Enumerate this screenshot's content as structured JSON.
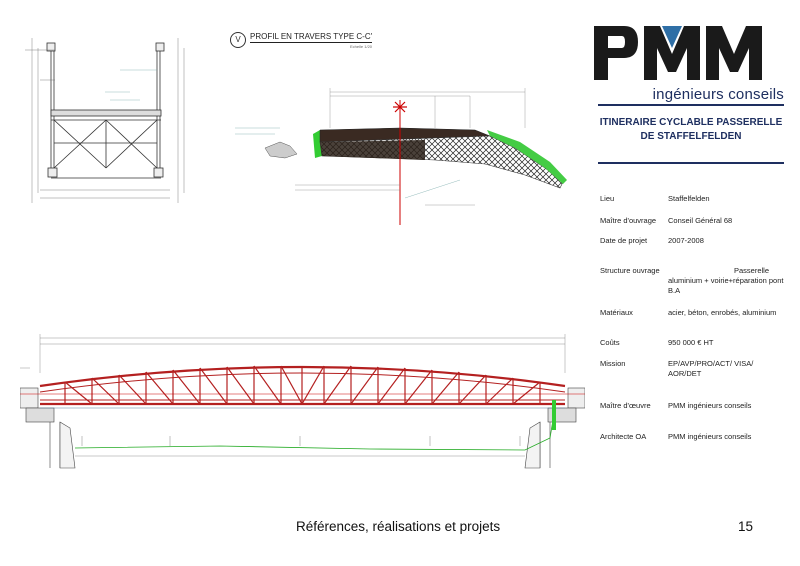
{
  "profile": {
    "marker": "V",
    "title": "PROFIL EN TRAVERS TYPE C-C'",
    "scale": "Echelle 1/20"
  },
  "logo": {
    "name": "PMM",
    "subtitle": "ingénieurs conseils",
    "colors": {
      "dark": "#1a1a1a",
      "blue": "#1e2f60",
      "accent": "#2f6fa6"
    }
  },
  "project": {
    "title_line1": "ITINERAIRE CYCLABLE PASSERELLE",
    "title_line2": "DE STAFFELFELDEN"
  },
  "details": {
    "lieu": {
      "label": "Lieu",
      "value": "Staffelfelden"
    },
    "maitre_ouvrage": {
      "label": "Maître d'ouvrage",
      "value": "Conseil Général 68"
    },
    "date": {
      "label": "Date de projet",
      "value": "2007-2008"
    },
    "structure": {
      "label": "Structure ouvrage",
      "value_right": "Passerelle",
      "value_cont": "aluminium + voirie+réparation pont B.A"
    },
    "materiaux": {
      "label": "Matériaux",
      "value": "acier, béton, enrobés, aluminium"
    },
    "couts": {
      "label": "Coûts",
      "value": "950 000 € HT"
    },
    "mission": {
      "label": "Mission",
      "value": "EP/AVP/PRO/ACT/ VISA/ AOR/DET"
    },
    "maitre_oeuvre": {
      "label": "Maître d'œuvre",
      "value": "PMM ingénieurs conseils"
    },
    "architecte": {
      "label": "Architecte OA",
      "value": "PMM ingénieurs conseils"
    }
  },
  "footer": {
    "text": "Références, réalisations et projets",
    "page": "15"
  }
}
